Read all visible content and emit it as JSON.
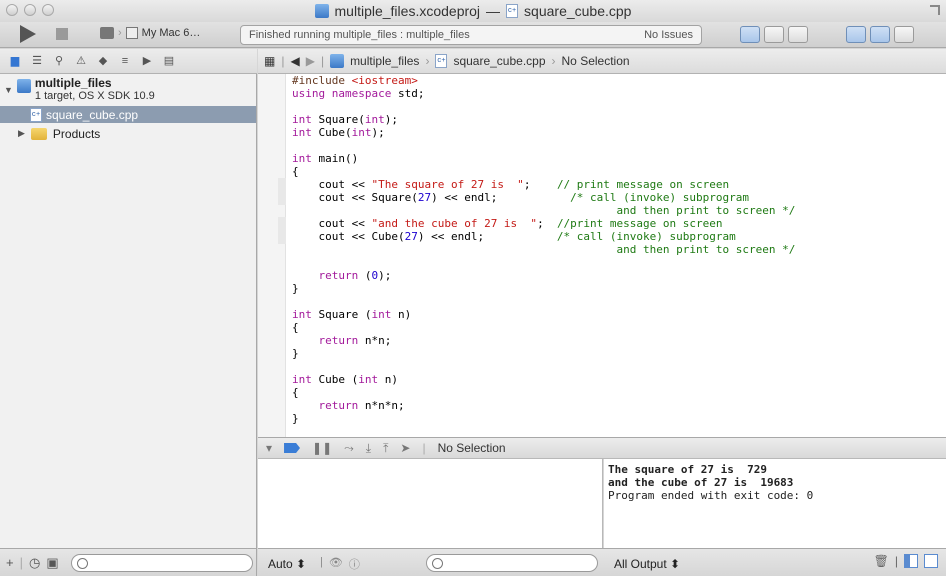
{
  "window": {
    "title_project": "multiple_files.xcodeproj",
    "title_separator": "—",
    "title_file": "square_cube.cpp"
  },
  "toolbar": {
    "scheme_device": "My Mac 6…",
    "activity_status": "Finished running multiple_files : multiple_files",
    "issues": "No Issues"
  },
  "navigator": {
    "project_name": "multiple_files",
    "project_subtitle": "1 target, OS X SDK 10.9",
    "selected_file": "square_cube.cpp",
    "group": "Products"
  },
  "jumpbar": {
    "project": "multiple_files",
    "file": "square_cube.cpp",
    "selection": "No Selection"
  },
  "colors": {
    "keyword": "#a31a9b",
    "string": "#c41a16",
    "comment": "#1f7a14",
    "number": "#1c00cf",
    "preprocessor": "#643820"
  },
  "code_lines": [
    [
      [
        "#include ",
        "preprocessor"
      ],
      [
        "<iostream>",
        "string"
      ]
    ],
    [
      [
        "using",
        "keyword"
      ],
      [
        " ",
        "plain"
      ],
      [
        "namespace",
        "keyword"
      ],
      [
        " std;",
        "plain"
      ]
    ],
    [
      [
        "",
        "plain"
      ]
    ],
    [
      [
        "int",
        "keyword"
      ],
      [
        " Square(",
        "plain"
      ],
      [
        "int",
        "keyword"
      ],
      [
        ");",
        "plain"
      ]
    ],
    [
      [
        "int",
        "keyword"
      ],
      [
        " Cube(",
        "plain"
      ],
      [
        "int",
        "keyword"
      ],
      [
        ");",
        "plain"
      ]
    ],
    [
      [
        "",
        "plain"
      ]
    ],
    [
      [
        "int",
        "keyword"
      ],
      [
        " main()",
        "plain"
      ]
    ],
    [
      [
        "{",
        "plain"
      ]
    ],
    [
      [
        "    cout << ",
        "plain"
      ],
      [
        "\"The square of 27 is  \"",
        "string"
      ],
      [
        ";    ",
        "plain"
      ],
      [
        "// print message on screen",
        "comment"
      ]
    ],
    [
      [
        "    cout << Square(",
        "plain"
      ],
      [
        "27",
        "number"
      ],
      [
        ") << endl;           ",
        "plain"
      ],
      [
        "/* call (invoke) subprogram",
        "comment"
      ]
    ],
    [
      [
        "                                                 and then print to screen */",
        "comment"
      ]
    ],
    [
      [
        "    cout << ",
        "plain"
      ],
      [
        "\"and the cube of 27 is  \"",
        "string"
      ],
      [
        ";  ",
        "plain"
      ],
      [
        "//print message on screen",
        "comment"
      ]
    ],
    [
      [
        "    cout << Cube(",
        "plain"
      ],
      [
        "27",
        "number"
      ],
      [
        ") << endl;           ",
        "plain"
      ],
      [
        "/* call (invoke) subprogram",
        "comment"
      ]
    ],
    [
      [
        "                                                 and then print to screen */",
        "comment"
      ]
    ],
    [
      [
        "",
        "plain"
      ]
    ],
    [
      [
        "    ",
        "plain"
      ],
      [
        "return",
        "keyword"
      ],
      [
        " (",
        "plain"
      ],
      [
        "0",
        "number"
      ],
      [
        ");",
        "plain"
      ]
    ],
    [
      [
        "}",
        "plain"
      ]
    ],
    [
      [
        "",
        "plain"
      ]
    ],
    [
      [
        "int",
        "keyword"
      ],
      [
        " Square (",
        "plain"
      ],
      [
        "int",
        "keyword"
      ],
      [
        " n)",
        "plain"
      ]
    ],
    [
      [
        "{",
        "plain"
      ]
    ],
    [
      [
        "    ",
        "plain"
      ],
      [
        "return",
        "keyword"
      ],
      [
        " n*n;",
        "plain"
      ]
    ],
    [
      [
        "}",
        "plain"
      ]
    ],
    [
      [
        "",
        "plain"
      ]
    ],
    [
      [
        "int",
        "keyword"
      ],
      [
        " Cube (",
        "plain"
      ],
      [
        "int",
        "keyword"
      ],
      [
        " n)",
        "plain"
      ]
    ],
    [
      [
        "{",
        "plain"
      ]
    ],
    [
      [
        "    ",
        "plain"
      ],
      [
        "return",
        "keyword"
      ],
      [
        " n*n*n;",
        "plain"
      ]
    ],
    [
      [
        "}",
        "plain"
      ]
    ]
  ],
  "debug": {
    "selection": "No Selection"
  },
  "console": {
    "line1": "The square of 27 is  729",
    "line2": "and the cube of 27 is  19683",
    "line3": "Program ended with exit code: 0"
  },
  "bottom": {
    "variables_scope": "Auto ⬍",
    "console_scope": "All Output ⬍"
  }
}
